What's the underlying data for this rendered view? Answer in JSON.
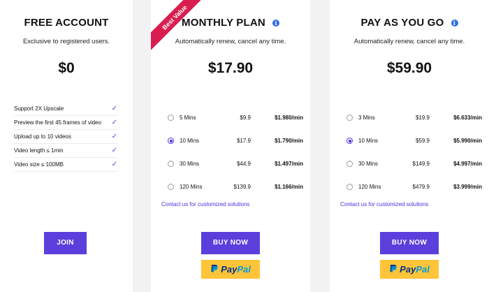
{
  "free": {
    "title": "FREE ACCOUNT",
    "subtitle": "Exclusive to registered users.",
    "price": "$0",
    "features": [
      "Support 2X Upscale",
      "Preview the first 45 frames of video",
      "Upload up to 10 videos",
      "Video length ≤ 1min",
      "Video size ≤ 100MB"
    ],
    "check_glyph": "✓",
    "button_label": "JOIN"
  },
  "monthly": {
    "title": "MONTHLY PLAN",
    "ribbon": "Best Value",
    "subtitle": "Automatically renew, cancel any time.",
    "price": "$17.90",
    "options": [
      {
        "duration": "5 Mins",
        "price": "$9.9",
        "rate": "$1.980/min",
        "selected": false
      },
      {
        "duration": "10 Mins",
        "price": "$17.9",
        "rate": "$1.790/min",
        "selected": true
      },
      {
        "duration": "30 Mins",
        "price": "$44.9",
        "rate": "$1.497/min",
        "selected": false
      },
      {
        "duration": "120 Mins",
        "price": "$139.9",
        "rate": "$1.166/min",
        "selected": false
      }
    ],
    "contact_link": "Contact us for customized solutions",
    "buy_label": "BUY NOW",
    "paypal_pay": "Pay",
    "paypal_pal": "Pal"
  },
  "payg": {
    "title": "PAY AS YOU GO",
    "subtitle": "Automatically renew, cancel any time.",
    "price": "$59.90",
    "options": [
      {
        "duration": "3 Mins",
        "price": "$19.9",
        "rate": "$6.633/min",
        "selected": false
      },
      {
        "duration": "10 Mins",
        "price": "$59.9",
        "rate": "$5.990/min",
        "selected": true
      },
      {
        "duration": "30 Mins",
        "price": "$149.9",
        "rate": "$4.997/min",
        "selected": false
      },
      {
        "duration": "120 Mins",
        "price": "$479.9",
        "rate": "$3.999/min",
        "selected": false
      }
    ],
    "contact_link": "Contact us for customized solutions",
    "buy_label": "BUY NOW",
    "paypal_pay": "Pay",
    "paypal_pal": "Pal"
  },
  "info_icon_glyph": "i",
  "colors": {
    "accent": "#5b3fdc",
    "ribbon": "#d91e4f",
    "paypal_bg": "#ffc439",
    "info": "#2f6fe0"
  }
}
